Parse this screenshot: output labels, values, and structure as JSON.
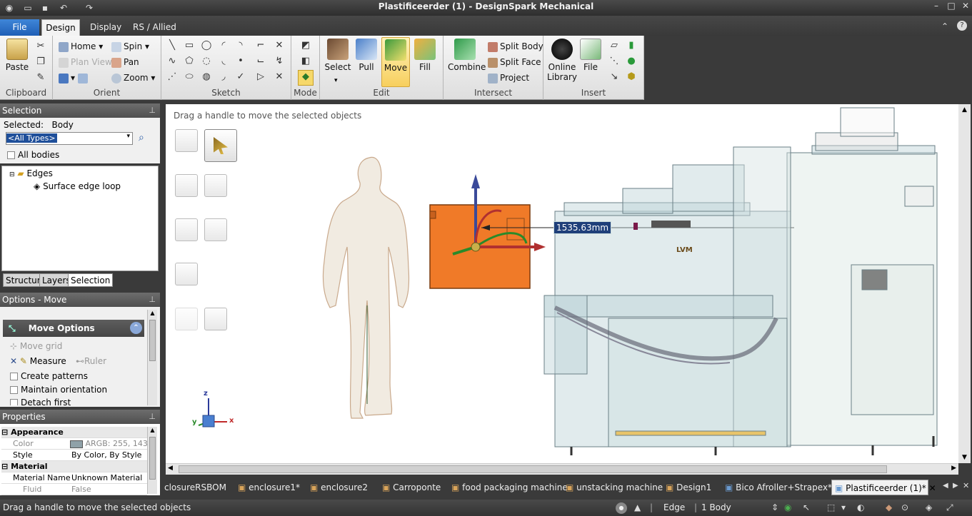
{
  "window": {
    "title": "Plastificeerder (1) - DesignSpark Mechanical"
  },
  "ribbon_tabs": [
    {
      "label": "File"
    },
    {
      "label": "Design"
    },
    {
      "label": "Display"
    },
    {
      "label": "RS / Allied"
    }
  ],
  "ribbon": {
    "clipboard": {
      "paste": "Paste",
      "group": "Clipboard"
    },
    "orient": {
      "home": "Home",
      "plan_view": "Plan View",
      "zoom": "Zoom",
      "spin": "Spin",
      "pan": "Pan",
      "group": "Orient"
    },
    "sketch": {
      "group": "Sketch"
    },
    "mode": {
      "group": "Mode"
    },
    "edit": {
      "select": "Select",
      "pull": "Pull",
      "move": "Move",
      "fill": "Fill",
      "group": "Edit"
    },
    "intersect": {
      "combine": "Combine",
      "split_body": "Split Body",
      "split_face": "Split Face",
      "project": "Project",
      "group": "Intersect"
    },
    "insert": {
      "online_library": "Online\nLibrary",
      "online_library_l1": "Online",
      "online_library_l2": "Library",
      "file": "File",
      "group": "Insert"
    }
  },
  "selection_panel": {
    "header": "Selection",
    "selected_label": "Selected:",
    "selected_value": "Body",
    "type_filter": "<All Types>",
    "all_bodies": "All bodies",
    "tree_root": "Edges",
    "tree_child": "Surface edge loop"
  },
  "panel_tabs": [
    {
      "label": "Structure"
    },
    {
      "label": "Layers"
    },
    {
      "label": "Selection"
    }
  ],
  "options_panel": {
    "header": "Options - Move",
    "section_title": "Move Options",
    "move_grid": "Move grid",
    "measure": "Measure",
    "ruler": "Ruler",
    "create_patterns": "Create patterns",
    "maintain_orientation": "Maintain orientation",
    "detach_first": "Detach first"
  },
  "properties_panel": {
    "header": "Properties",
    "appearance": "Appearance",
    "color_label": "Color",
    "color_value": "ARGB: 255, 143",
    "style_label": "Style",
    "style_value": "By Color, By Style",
    "material": "Material",
    "material_name_label": "Material Name",
    "material_name_value": "Unknown Material",
    "fluid_label": "Fluid",
    "fluid_value": "False"
  },
  "viewport": {
    "hint": "Drag a handle to move the selected objects",
    "dimension": "1535.63mm",
    "axis_z": "z",
    "axis_y": "y",
    "axis_x": "x",
    "machine_label": "LVM"
  },
  "doc_tabs": [
    {
      "label": "closureRSBOM"
    },
    {
      "label": "enclosure1*"
    },
    {
      "label": "enclosure2"
    },
    {
      "label": "Carroponte"
    },
    {
      "label": "food packaging machine"
    },
    {
      "label": "unstacking machine"
    },
    {
      "label": "Design1"
    },
    {
      "label": "Bico Afroller+Strapex*"
    },
    {
      "label": "Plastificeerder (1)*"
    }
  ],
  "status": {
    "message": "Drag a handle to move the selected objects",
    "filter": "Edge",
    "count": "1 Body"
  },
  "colors": {
    "accent": "#f4c542",
    "file_tab": "#2a6bc4",
    "selected_box": "#f07a28"
  }
}
